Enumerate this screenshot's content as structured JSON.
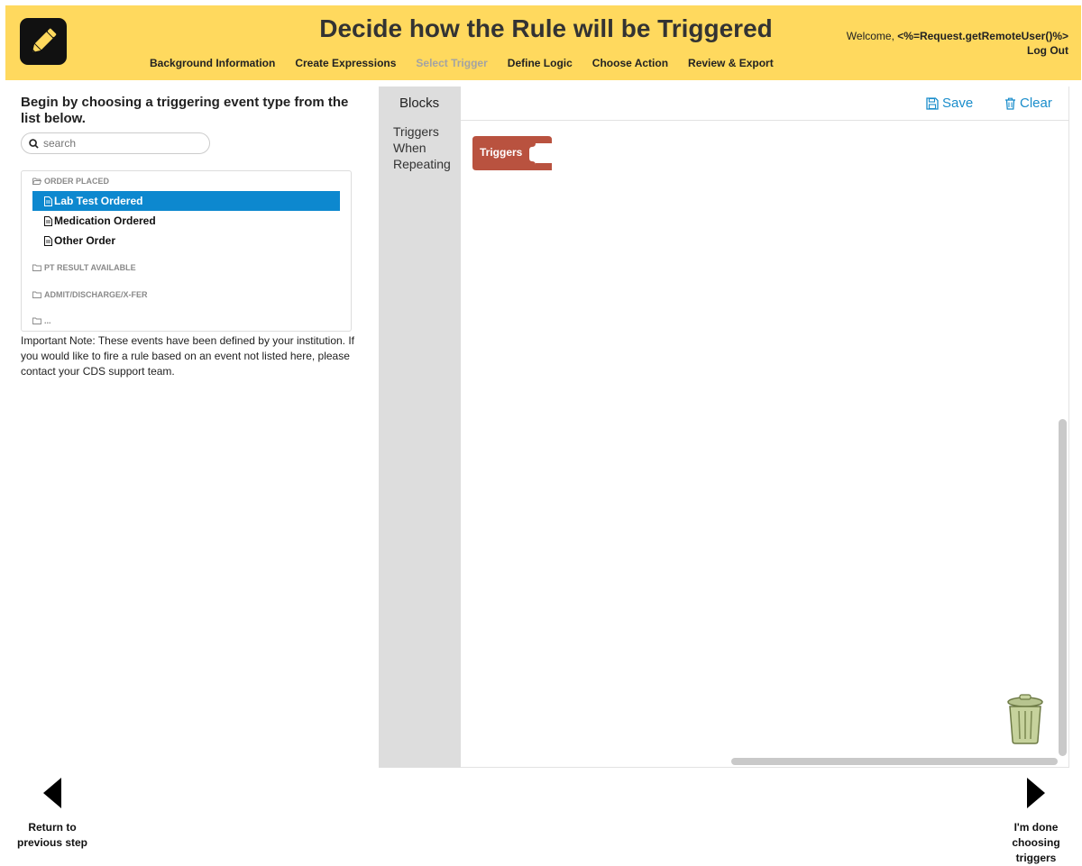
{
  "header": {
    "title": "Decide how the Rule will be Triggered",
    "logo_icon": "pencil-icon",
    "nav": [
      {
        "label": "Background Information",
        "state": "active"
      },
      {
        "label": "Create Expressions",
        "state": "active"
      },
      {
        "label": "Select Trigger",
        "state": "current-disabled"
      },
      {
        "label": "Define Logic",
        "state": "active"
      },
      {
        "label": "Choose Action",
        "state": "active"
      },
      {
        "label": "Review & Export",
        "state": "active"
      }
    ],
    "welcome_prefix": "Welcome,",
    "welcome_user": "<%=Request.getRemoteUser()%>",
    "logout_label": "Log Out",
    "background_color": "#ffd95e"
  },
  "left_panel": {
    "instructions": "Begin by choosing a triggering event type from the list below.",
    "search_placeholder": "search",
    "tree": {
      "groups": [
        {
          "label": "ORDER PLACED",
          "items": [
            "Lab Test Ordered",
            "Medication Ordered",
            "Other Order"
          ]
        },
        {
          "label": "PT RESULT AVAILABLE",
          "items": []
        },
        {
          "label": "ADMIT/DISCHARGE/X-FER",
          "items": []
        },
        {
          "label": "...",
          "items": []
        }
      ],
      "selected_item": "Lab Test Ordered"
    },
    "note": "Important Note: These events have been defined by your institution. If you would like to fire a rule based on an event not listed here, please contact your CDS support team."
  },
  "workspace": {
    "blocks_title": "Blocks",
    "categories": [
      "Triggers",
      "When",
      "Repeating"
    ],
    "save_label": "Save",
    "clear_label": "Clear",
    "block_label": "Triggers",
    "block_color": "#b9523f",
    "accent_color": "#1a8dcb"
  },
  "footer": {
    "prev_label": "Return to previous step",
    "next_label": "I'm done choosing triggers"
  }
}
